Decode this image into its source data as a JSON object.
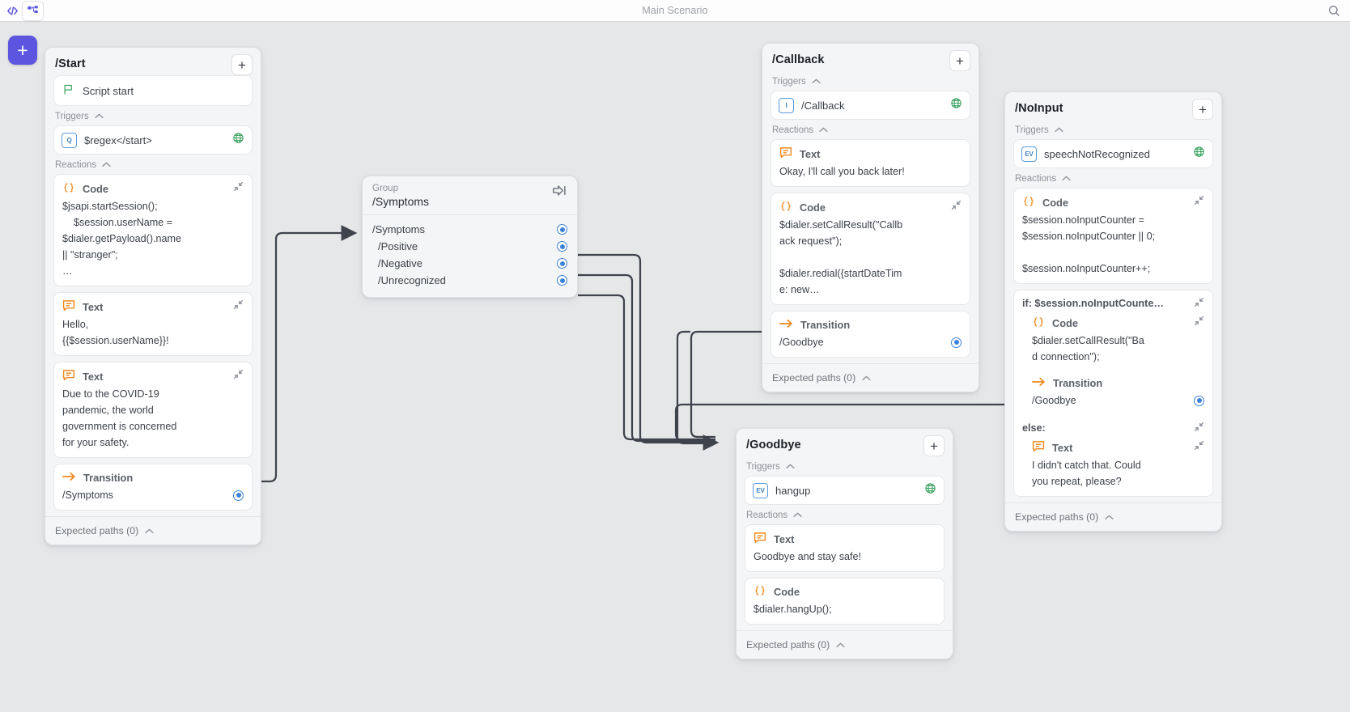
{
  "topbar": {
    "title": "Main Scenario",
    "icons": {
      "code": "code-brackets-icon",
      "tree": "hierarchy-icon",
      "search": "search-icon"
    }
  },
  "canvas": {
    "add_button_label": "+"
  },
  "labels": {
    "triggers": "Triggers",
    "reactions": "Reactions",
    "expected_paths": "Expected paths (0)",
    "plus": "+",
    "code": "Code",
    "text": "Text",
    "transition": "Transition",
    "group": "Group",
    "else": "else:"
  },
  "nodes": {
    "start": {
      "title": "/Start",
      "script_start": "Script start",
      "trigger": {
        "badge": "Q",
        "label": "$regex</start>"
      },
      "reactions": [
        {
          "kind": "Code",
          "body": "$jsapi.startSession();\n    $session.userName =\n$dialer.getPayload().name\n|| \"stranger\";\n…"
        },
        {
          "kind": "Text",
          "body": "Hello,\n{{$session.userName}}!"
        },
        {
          "kind": "Text",
          "body": "Due to the COVID-19\npandemic, the world\ngovernment is concerned\nfor your safety."
        },
        {
          "kind": "Transition",
          "body": "/Symptoms"
        }
      ]
    },
    "symptoms_group": {
      "kind": "Group",
      "name": "/Symptoms",
      "items": [
        {
          "label": "/Symptoms",
          "child": false
        },
        {
          "label": "/Positive",
          "child": true
        },
        {
          "label": "/Negative",
          "child": true
        },
        {
          "label": "/Unrecognized",
          "child": true
        }
      ]
    },
    "callback": {
      "title": "/Callback",
      "trigger": {
        "badge": "I",
        "label": "/Callback"
      },
      "reactions": [
        {
          "kind": "Text",
          "body": "Okay, I'll call you back later!"
        },
        {
          "kind": "Code",
          "body": "$dialer.setCallResult(\"Callb\nack request\");\n\n$dialer.redial({startDateTim\ne: new…"
        },
        {
          "kind": "Transition",
          "body": "/Goodbye"
        }
      ]
    },
    "noinput": {
      "title": "/NoInput",
      "trigger": {
        "badge": "EV",
        "label": "speechNotRecognized"
      },
      "code": {
        "kind": "Code",
        "body": "$session.noInputCounter =\n$session.noInputCounter || 0;\n\n$session.noInputCounter++;"
      },
      "condition": "if: $session.noInputCounte…",
      "if_branch": [
        {
          "kind": "Code",
          "body": "$dialer.setCallResult(\"Ba\nd connection\");"
        },
        {
          "kind": "Transition",
          "body": "/Goodbye"
        }
      ],
      "else_branch": [
        {
          "kind": "Text",
          "body": "I didn't catch that. Could\nyou repeat, please?"
        }
      ]
    },
    "goodbye": {
      "title": "/Goodbye",
      "trigger": {
        "badge": "EV",
        "label": "hangup"
      },
      "reactions": [
        {
          "kind": "Text",
          "body": "Goodbye and stay safe!"
        },
        {
          "kind": "Code",
          "body": "$dialer.hangUp();"
        }
      ]
    }
  },
  "colors": {
    "accent": "#5b55e0",
    "orange": "#f08a1e",
    "green": "#3fa564",
    "blue": "#3b82d9",
    "canvas": "#e6e7e9",
    "wire": "#3e434c"
  }
}
